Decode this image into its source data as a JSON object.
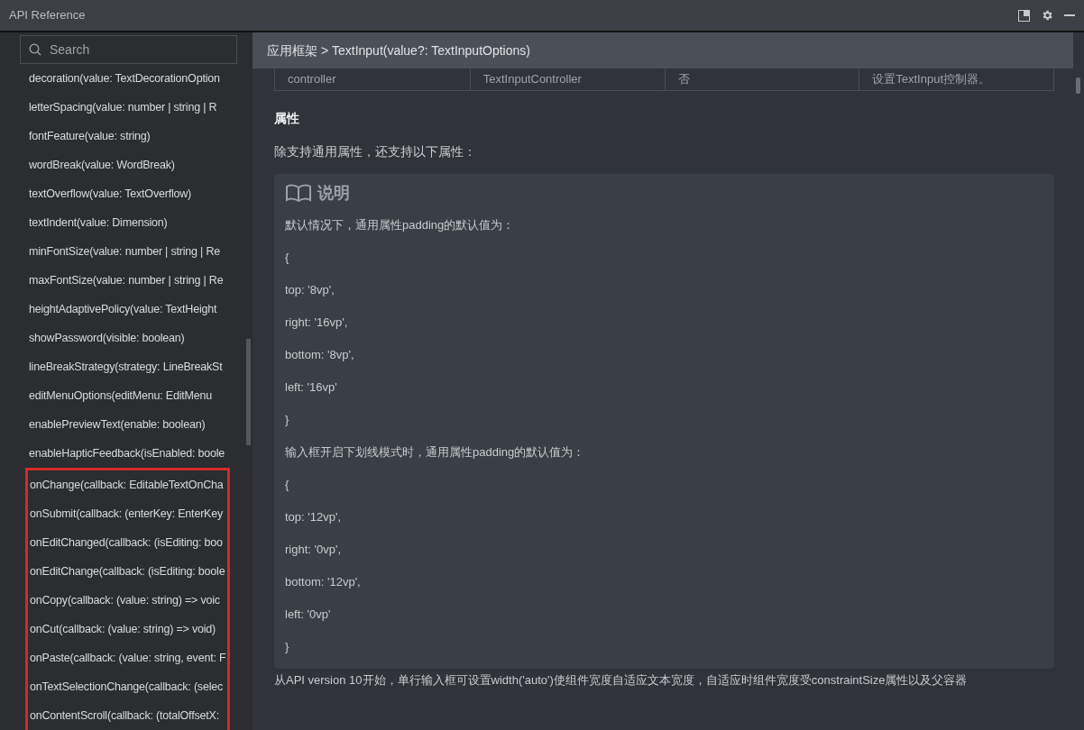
{
  "window": {
    "title": "API Reference"
  },
  "sidebar": {
    "search": {
      "placeholder": "Search"
    },
    "groups": [
      {
        "highlighted": false,
        "items": [
          "decoration(value: TextDecorationOption",
          "letterSpacing(value: number | string | R",
          "fontFeature(value: string)",
          "wordBreak(value: WordBreak)",
          "textOverflow(value: TextOverflow)",
          "textIndent(value: Dimension)",
          "minFontSize(value: number | string | Re",
          "maxFontSize(value: number | string | Re",
          "heightAdaptivePolicy(value: TextHeight",
          "showPassword(visible: boolean)",
          "lineBreakStrategy(strategy: LineBreakSt",
          "editMenuOptions(editMenu: EditMenu",
          "enablePreviewText(enable: boolean)",
          "enableHapticFeedback(isEnabled: boole"
        ]
      },
      {
        "highlighted": true,
        "items": [
          "onChange(callback: EditableTextOnCha",
          "onSubmit(callback: (enterKey: EnterKey",
          "onEditChanged(callback: (isEditing: boo",
          "onEditChange(callback: (isEditing: boole",
          "onCopy(callback: (value: string) => voic",
          "onCut(callback: (value: string) => void)",
          "onPaste(callback: (value: string, event: F",
          "onTextSelectionChange(callback: (selec",
          "onContentScroll(callback: (totalOffsetX:"
        ]
      }
    ]
  },
  "breadcrumb": "应用框架 > TextInput(value?: TextInputOptions)",
  "table_row": [
    "controller",
    "TextInputController",
    "否",
    "设置TextInput控制器。"
  ],
  "section_title": "属性",
  "intro": "除支持通用属性，还支持以下属性：",
  "note": {
    "title": "说明",
    "lines": [
      "默认情况下，通用属性padding的默认值为：",
      "{",
      "top: '8vp',",
      "right: '16vp',",
      "bottom: '8vp',",
      "left: '16vp'",
      "}",
      "输入框开启下划线模式时，通用属性padding的默认值为：",
      "{",
      "top: '12vp',",
      "right: '0vp',",
      "bottom: '12vp',",
      "left: '0vp'",
      "}"
    ]
  },
  "footer_text": "从API version 10开始，单行输入框可设置width('auto')使组件宽度自适应文本宽度，自适应时组件宽度受constraintSize属性以及父容器"
}
